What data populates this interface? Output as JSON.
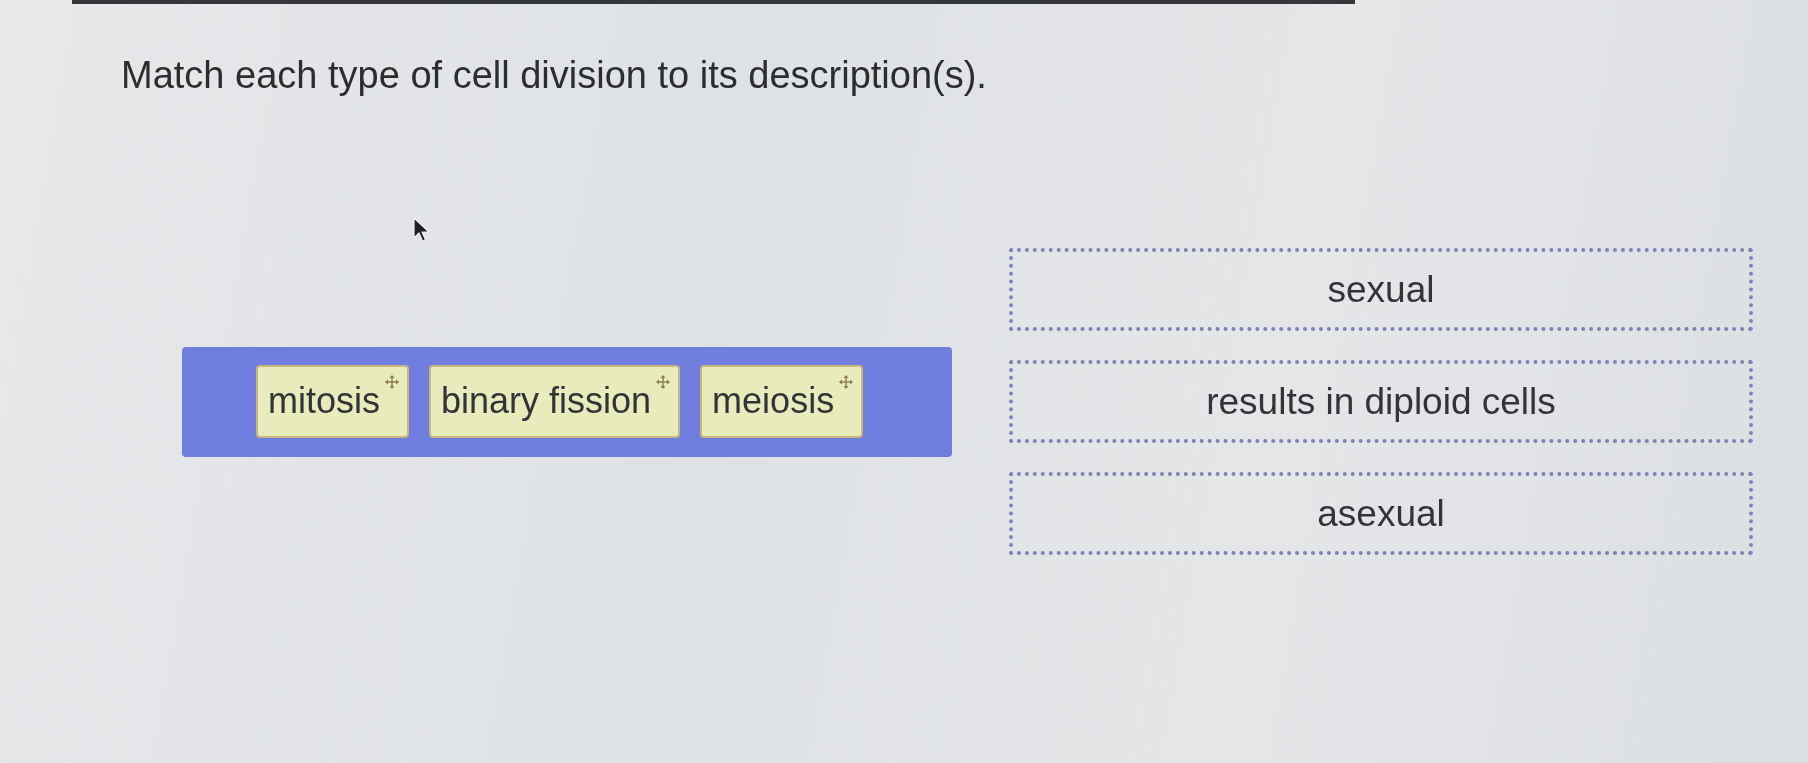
{
  "title": "Match each type of cell division to its description(s).",
  "choices": [
    {
      "label": "mitosis"
    },
    {
      "label": "binary fission"
    },
    {
      "label": "meiosis"
    }
  ],
  "targets": [
    {
      "label": "sexual"
    },
    {
      "label": "results in diploid cells"
    },
    {
      "label": "asexual"
    }
  ]
}
